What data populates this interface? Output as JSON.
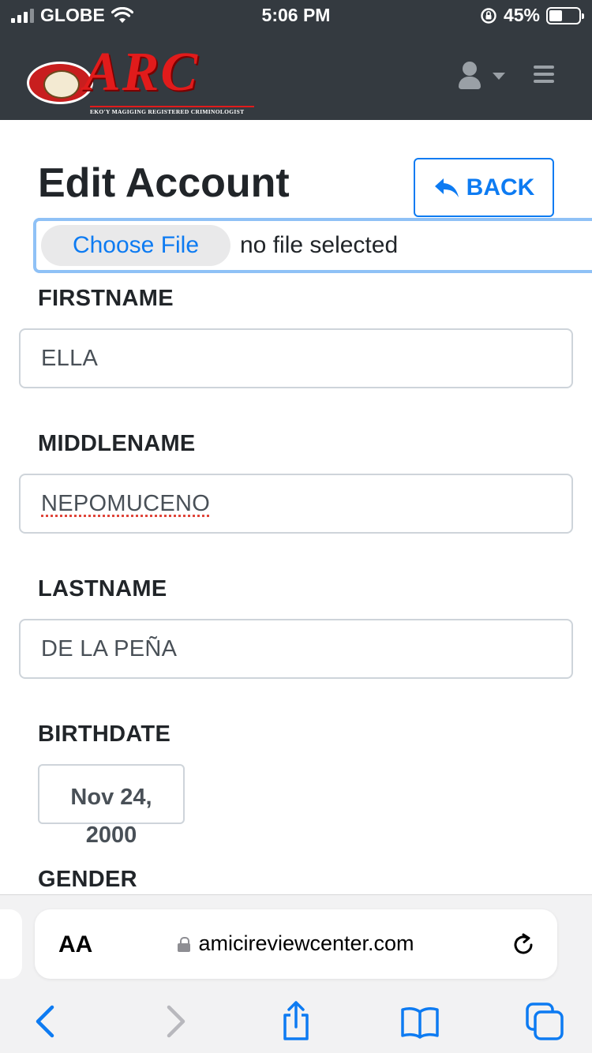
{
  "status_bar": {
    "carrier": "GLOBE",
    "time": "5:06 PM",
    "battery_percent": "45%",
    "battery_level": 0.45,
    "icons": [
      "signal-icon",
      "wifi-icon",
      "orientation-lock-icon",
      "battery-icon"
    ]
  },
  "navbar": {
    "logo_text": "ARC",
    "logo_subtitle": "EKO'Y MAGIGING REGISTERED CRIMINOLOGIST",
    "user_icon": "user-icon",
    "menu_icon": "hamburger-icon"
  },
  "page": {
    "title": "Edit Account",
    "back_label": "BACK"
  },
  "file_input": {
    "button_label": "Choose File",
    "status": "no file selected"
  },
  "form": {
    "firstname_label": "FIRSTNAME",
    "firstname_value": "ELLA",
    "middlename_label": "MIDDLENAME",
    "middlename_value": "NEPOMUCENO",
    "lastname_label": "LASTNAME",
    "lastname_value": "DE LA PEÑA",
    "birthdate_label": "BIRTHDATE",
    "birthdate_line1": "Nov 24,",
    "birthdate_line2": "2000",
    "gender_label": "GENDER"
  },
  "browser": {
    "text_size_button": "AA",
    "url": "amicireviewcenter.com"
  },
  "colors": {
    "navbar_bg": "#343a40",
    "accent_blue": "#0d7bf2",
    "logo_red": "#e11b1b"
  }
}
